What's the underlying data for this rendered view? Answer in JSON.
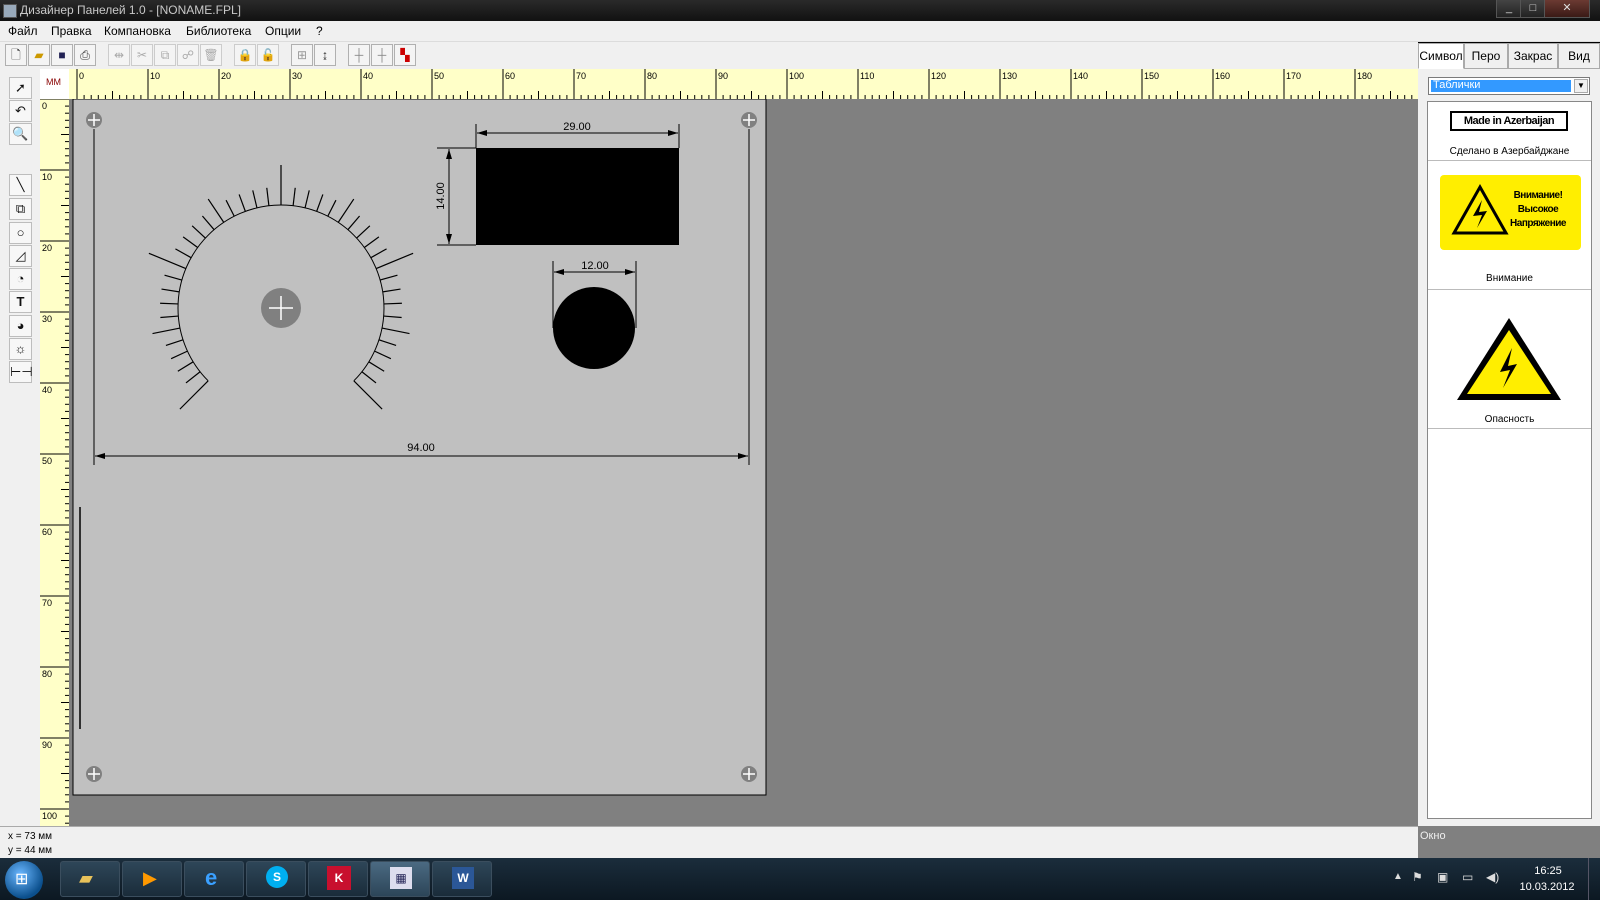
{
  "window": {
    "title": "Дизайнер Панелей 1.0   -   [NONAME.FPL]",
    "controls": {
      "minimize": "_",
      "maximize": "□",
      "close": "✕"
    }
  },
  "menu": {
    "items": [
      "Файл",
      "Правка",
      "Компановка",
      "Библиотека",
      "Опции",
      "?"
    ]
  },
  "tabs": [
    "Символ",
    "Перо",
    "Закрас",
    "Вид"
  ],
  "ruler": {
    "unit": "ММ",
    "h_labels": [
      "0",
      "10",
      "20",
      "30",
      "40",
      "50",
      "60",
      "70",
      "80",
      "90",
      "100",
      "110",
      "120",
      "130",
      "140",
      "150",
      "160",
      "170",
      "180"
    ],
    "v_labels": [
      "0",
      "10",
      "20",
      "30",
      "40",
      "50",
      "60",
      "70",
      "80",
      "90",
      "100"
    ]
  },
  "canvas": {
    "dim_rect_w": "29.00",
    "dim_rect_h": "14.00",
    "dim_circle": "12.00",
    "dim_panel_w": "94.00"
  },
  "library": {
    "category": "Таблички",
    "items": [
      {
        "sign_text": "Made in Azerbaijan",
        "caption": "Сделано в Азербайджане"
      },
      {
        "sign_text_lines": [
          "Внимание!",
          "Высокое",
          "Напряжение"
        ],
        "caption": "Внимание"
      },
      {
        "caption": "Опасность"
      }
    ]
  },
  "status": {
    "x": "x = 73 мм",
    "y": "y = 44 мм",
    "right": "Окно"
  },
  "taskbar": {
    "time": "16:25",
    "date": "10.03.2012"
  },
  "colors": {
    "ruler": "#ffffc8",
    "panel": "#c0c0c0",
    "workspace": "#808080",
    "warning_yellow": "#ffee00"
  }
}
